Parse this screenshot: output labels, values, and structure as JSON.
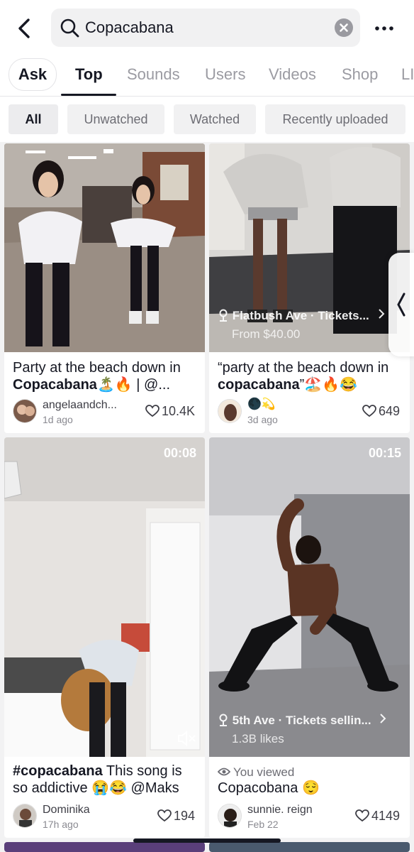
{
  "search": {
    "query": "Copacabana"
  },
  "tabs": [
    "Ask",
    "Top",
    "Sounds",
    "Users",
    "Videos",
    "Shop",
    "LI"
  ],
  "filters": [
    "All",
    "Unwatched",
    "Watched",
    "Recently uploaded"
  ],
  "videos": [
    {
      "caption_pre": "Party at the beach down in ",
      "caption_bold": "Copacabana",
      "caption_post": "🏝️🔥 | @...",
      "author": "angelaandch...",
      "date": "1d ago",
      "likes": "10.4K"
    },
    {
      "location": "Flatbush Ave · Tickets...",
      "location_sub": "From $40.00",
      "caption_pre": "“party at the beach down in ",
      "caption_bold": "copacabana",
      "caption_post": "”🏖️🔥😂",
      "author": "🌑💫",
      "date": "3d ago",
      "likes": "649"
    },
    {
      "duration": "00:08",
      "caption_pre": "",
      "caption_bold": "#copacabana",
      "caption_post": " This song is so addictive 😭😂 @Maks",
      "author": "Dominika",
      "date": "17h ago",
      "likes": "194"
    },
    {
      "duration": "00:15",
      "location": "5th Ave · Tickets sellin...",
      "location_sub": "1.3B likes",
      "viewed_label": "You viewed",
      "caption_pre": "Copacobana 😌",
      "caption_bold": "",
      "caption_post": "",
      "author": "sunnie. reign",
      "date": "Feb 22",
      "likes": "4149"
    }
  ]
}
